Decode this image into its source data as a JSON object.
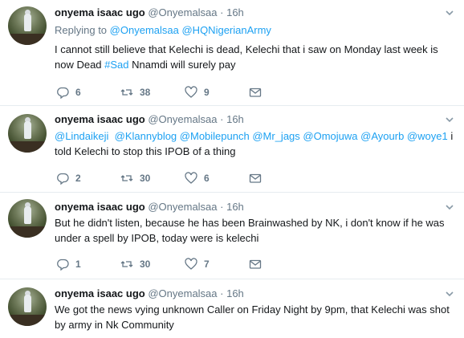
{
  "tweets": [
    {
      "name": "onyema isaac ugo",
      "handle": "@Onyemalsaa",
      "time": "· 16h",
      "replying_prefix": "Replying to",
      "replying_to": [
        "@Onyemalsaa",
        "@HQNigerianArmy"
      ],
      "text_before": "I cannot still believe that Kelechi is dead, Kelechi that i saw on Monday last week is now Dead ",
      "hashtag": "#Sad",
      "text_after": " Nnamdi will surely pay",
      "replies": "6",
      "retweets": "38",
      "likes": "9"
    },
    {
      "name": "onyema isaac ugo",
      "handle": "@Onyemalsaa",
      "time": "· 16h",
      "mentions": [
        "@Lindaikeji",
        "@Klannyblog",
        "@Mobilepunch",
        "@Mr_jags",
        "@Omojuwa",
        "@Ayourb",
        "@woye1"
      ],
      "text": " i told Kelechi to stop this IPOB of a thing",
      "replies": "2",
      "retweets": "30",
      "likes": "6"
    },
    {
      "name": "onyema isaac ugo",
      "handle": "@Onyemalsaa",
      "time": "· 16h",
      "text": "But he didn't listen, because he has been Brainwashed by NK, i don't know if he was under a spell by IPOB, today were is kelechi",
      "replies": "1",
      "retweets": "30",
      "likes": "7"
    },
    {
      "name": "onyema isaac ugo",
      "handle": "@Onyemalsaa",
      "time": "· 16h",
      "text": "We got the news vying unknown Caller on Friday Night by 9pm, that Kelechi was shot by army in Nk Community"
    }
  ],
  "icons": {
    "reply": "reply-icon",
    "retweet": "retweet-icon",
    "like": "heart-icon",
    "message": "envelope-icon",
    "menu": "chevron-down-icon"
  },
  "colors": {
    "link": "#1da1f2",
    "secondary": "#657786"
  }
}
